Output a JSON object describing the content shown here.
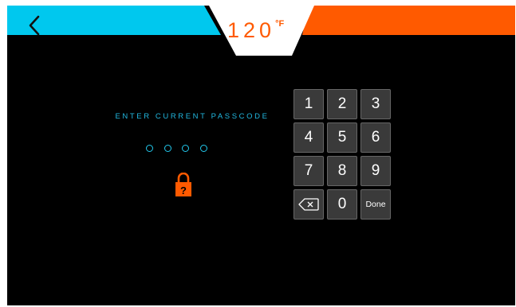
{
  "header": {
    "back_icon": "chevron-left-icon",
    "temperature_value": "120",
    "temperature_unit": "°F",
    "accent_left": "#00c8ee",
    "accent_right": "#ff5a00",
    "temperature_color": "#ff5a00"
  },
  "passcode": {
    "prompt": "ENTER CURRENT PASSCODE",
    "digits_entered": 0,
    "digits_total": 4,
    "lock_icon": "padlock-question-icon",
    "lock_color": "#ff5a00"
  },
  "keypad": {
    "keys": [
      {
        "label": "1"
      },
      {
        "label": "2"
      },
      {
        "label": "3"
      },
      {
        "label": "4"
      },
      {
        "label": "5"
      },
      {
        "label": "6"
      },
      {
        "label": "7"
      },
      {
        "label": "8"
      },
      {
        "label": "9"
      },
      {
        "label": "",
        "icon": "backspace-icon"
      },
      {
        "label": "0"
      },
      {
        "label": "Done"
      }
    ]
  }
}
